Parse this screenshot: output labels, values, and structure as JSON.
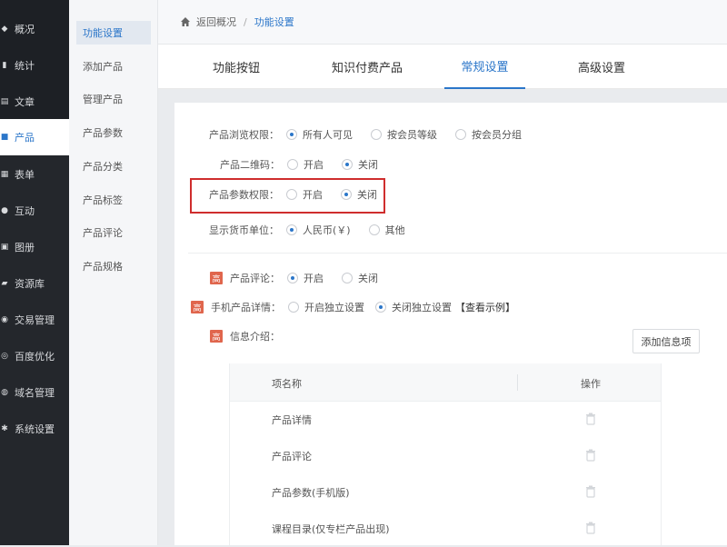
{
  "sidebar": {
    "items": [
      {
        "label": "概况",
        "icon": "dashboard-icon"
      },
      {
        "label": "统计",
        "icon": "chart-icon"
      },
      {
        "label": "文章",
        "icon": "article-icon"
      },
      {
        "label": "产品",
        "icon": "product-icon"
      },
      {
        "label": "表单",
        "icon": "form-icon"
      },
      {
        "label": "互动",
        "icon": "chat-icon"
      },
      {
        "label": "图册",
        "icon": "gallery-icon"
      },
      {
        "label": "资源库",
        "icon": "folder-icon"
      },
      {
        "label": "交易管理",
        "icon": "trade-icon"
      },
      {
        "label": "百度优化",
        "icon": "seo-icon"
      },
      {
        "label": "域名管理",
        "icon": "globe-icon"
      },
      {
        "label": "系统设置",
        "icon": "gear-icon"
      }
    ],
    "active_index": 3
  },
  "submenu": {
    "items": [
      "功能设置",
      "添加产品",
      "管理产品",
      "产品参数",
      "产品分类",
      "产品标签",
      "产品评论",
      "产品规格"
    ],
    "active_index": 0
  },
  "breadcrumb": {
    "back": "返回概况",
    "separator": "/",
    "current": "功能设置"
  },
  "tabs": [
    "功能按钮",
    "知识付费产品",
    "常规设置",
    "高级设置"
  ],
  "active_tab": 2,
  "settings": {
    "browse": {
      "label": "产品浏览权限：",
      "options": [
        "所有人可见",
        "按会员等级",
        "按会员分组"
      ],
      "selected": 0
    },
    "qrcode": {
      "label": "产品二维码：",
      "options": [
        "开启",
        "关闭"
      ],
      "selected": 1
    },
    "param_perm": {
      "label": "产品参数权限：",
      "options": [
        "开启",
        "关闭"
      ],
      "selected": 1
    },
    "currency": {
      "label": "显示货币单位：",
      "options": [
        "人民币(￥)",
        "其他"
      ],
      "selected": 0
    },
    "comment": {
      "badge": "高",
      "label": "产品评论：",
      "options": [
        "开启",
        "关闭"
      ],
      "selected": 0
    },
    "mobile_detail": {
      "badge": "高",
      "label": "手机产品详情：",
      "options": [
        "开启独立设置",
        "关闭独立设置"
      ],
      "selected": 1,
      "link": "【查看示例】"
    },
    "info": {
      "badge": "高",
      "label": "信息介绍："
    }
  },
  "add_button": "添加信息项",
  "table": {
    "headers": [
      "项名称",
      "操作"
    ],
    "rows": [
      "产品详情",
      "产品评论",
      "产品参数(手机版)",
      "课程目录(仅专栏产品出现)"
    ]
  },
  "colors": {
    "accent": "#2b76c9",
    "highlight_box": "#cf2d2d",
    "badge": "#e0664d",
    "sidebar_bg": "#24272c"
  }
}
